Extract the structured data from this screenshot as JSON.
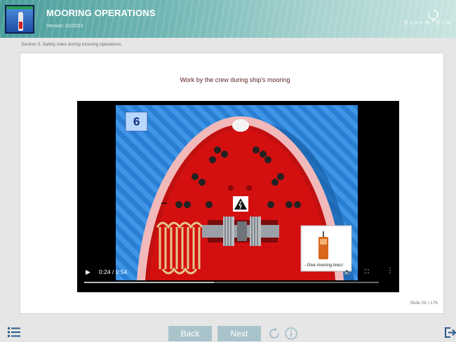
{
  "header": {
    "title": "MOORING OPERATIONS",
    "version": "Version: 02/2023",
    "brand": "Storm Sim",
    "colors": {
      "header_start": "#4a9d9b",
      "header_end": "#c9e4e1"
    }
  },
  "breadcrumb": "Section 3. Safety rules during mooring operations.",
  "slide": {
    "title": "Work by the crew during ship's mooring",
    "number": "Slide 26 / 176"
  },
  "video": {
    "scene_number": "6",
    "caption": "- Give mooring lines!",
    "time": "0:24 / 0:54",
    "progress_fraction": 0.44,
    "controls": [
      "play-icon",
      "volume-icon",
      "fullscreen-icon",
      "more-options-icon"
    ],
    "colors": {
      "deck": "#d30f10",
      "sea": "#2a7fd4",
      "bulwark": "#f1b9b9"
    }
  },
  "footer": {
    "back_label": "Back",
    "next_label": "Next",
    "icons": [
      "menu-icon",
      "replay-icon",
      "info-icon",
      "exit-icon"
    ],
    "button_color": "#a9c3cb"
  }
}
